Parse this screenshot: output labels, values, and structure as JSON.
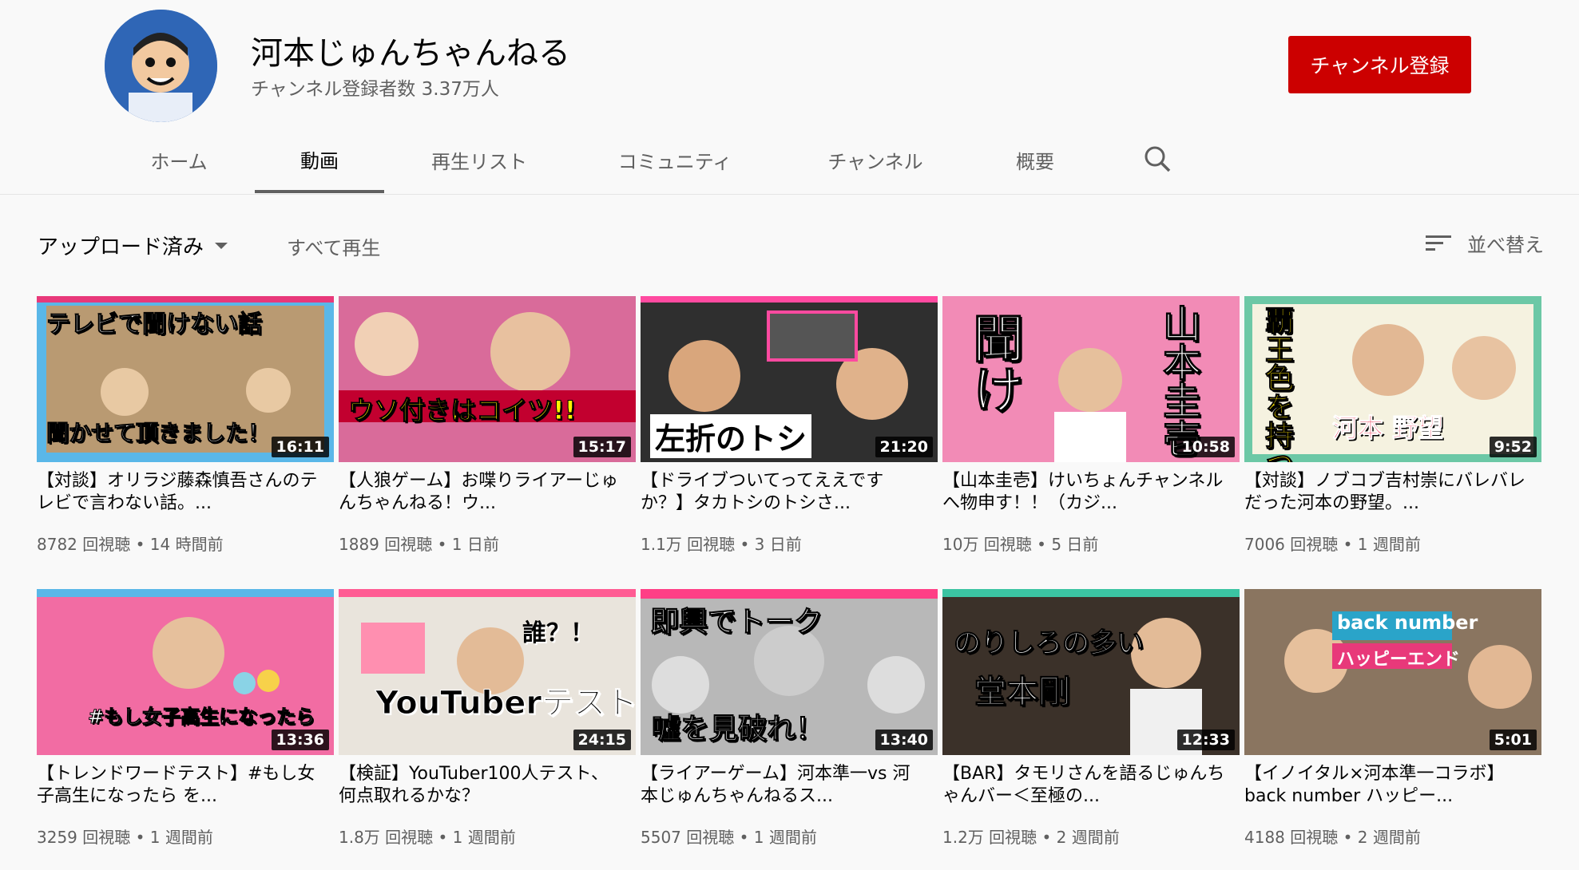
{
  "channel": {
    "name": "河本じゅんちゃんねる",
    "subscribers": "チャンネル登録者数 3.37万人",
    "subscribe_label": "チャンネル登録"
  },
  "tabs": [
    {
      "label": "ホーム"
    },
    {
      "label": "動画",
      "active": true
    },
    {
      "label": "再生リスト"
    },
    {
      "label": "コミュニティ"
    },
    {
      "label": "チャンネル"
    },
    {
      "label": "概要"
    }
  ],
  "toolbar": {
    "uploads_label": "アップロード済み",
    "play_all_label": "すべて再生",
    "sort_label": "並べ替え"
  },
  "videos": [
    {
      "caption": "テレビで聞けない話",
      "caption2": "聞かせて頂きました！",
      "duration": "16:11",
      "title": "【対談】オリラジ藤森慎吾さんのテレビで言わない話。...",
      "meta": "8782 回視聴 • 14 時間前",
      "bg": "#5ab7e8",
      "accent": "#e8397a"
    },
    {
      "caption": "ウソ付きはコイツ!!",
      "caption2": "",
      "duration": "15:17",
      "title": "【人狼ゲーム】お喋りライアーじゅんちゃんねる！ウ...",
      "meta": "1889 回視聴 • 1 日前",
      "bg": "#d96b9a",
      "accent": "#c2002f"
    },
    {
      "caption": "左折のトシ",
      "caption2": "",
      "duration": "21:20",
      "title": "【ドライブついてってええですか？】タカトシのトシさ...",
      "meta": "1.1万 回視聴 • 3 日前",
      "bg": "#2f2f2f",
      "accent": "#ff4aa0"
    },
    {
      "caption": "聞け",
      "caption2": "山本圭壱",
      "duration": "10:58",
      "title": "【山本圭壱】けいちょんチャンネルへ物申す！！（カジ...",
      "meta": "10万 回視聴 • 5 日前",
      "bg": "#f28bb6",
      "accent": "#ffffff"
    },
    {
      "caption": "覇王色を持つ男",
      "caption2": "河本 野望",
      "duration": "9:52",
      "title": "【対談】ノブコブ吉村崇にバレバレだった河本の野望。...",
      "meta": "7006 回視聴 • 1 週間前",
      "bg": "#6cc8a6",
      "accent": "#e8002a"
    },
    {
      "caption": "#もし女子高生になったら",
      "caption2": "",
      "duration": "13:36",
      "title": "【トレンドワードテスト】#もし女子高生になったら を...",
      "meta": "3259 回視聴 • 1 週間前",
      "bg": "#f26ca3",
      "accent": "#ffffff"
    },
    {
      "caption": "YouTuberテスト",
      "caption2": "誰？！",
      "duration": "24:15",
      "title": "【検証】YouTuber100人テスト、何点取れるかな？",
      "meta": "1.8万 回視聴 • 1 週間前",
      "bg": "#e9e4dc",
      "accent": "#ff5c93"
    },
    {
      "caption": "即興でトーク",
      "caption2": "嘘を見破れ！",
      "duration": "13:40",
      "title": "【ライアーゲーム】河本準一vs 河本じゅんちゃんねるス...",
      "meta": "5507 回視聴 • 1 週間前",
      "bg": "#b8b8b8",
      "accent": "#ff3f86"
    },
    {
      "caption": "のりしろの多い",
      "caption2": "堂本剛",
      "duration": "12:33",
      "title": "【BAR】タモリさんを語るじゅんちゃんバー＜至極の...",
      "meta": "1.2万 回視聴 • 2 週間前",
      "bg": "#3b3129",
      "accent": "#ffffff"
    },
    {
      "caption": "back number",
      "caption2": "ハッピーエンド",
      "duration": "5:01",
      "title": "【イノイタル×河本準一コラボ】back number ハッピー...",
      "meta": "4188 回視聴 • 2 週間前",
      "bg": "#8a7560",
      "accent": "#2aa4c9"
    }
  ],
  "colors": {
    "subscribe": "#cc0000",
    "muted_text": "#606060",
    "background": "#f9f9f9"
  }
}
